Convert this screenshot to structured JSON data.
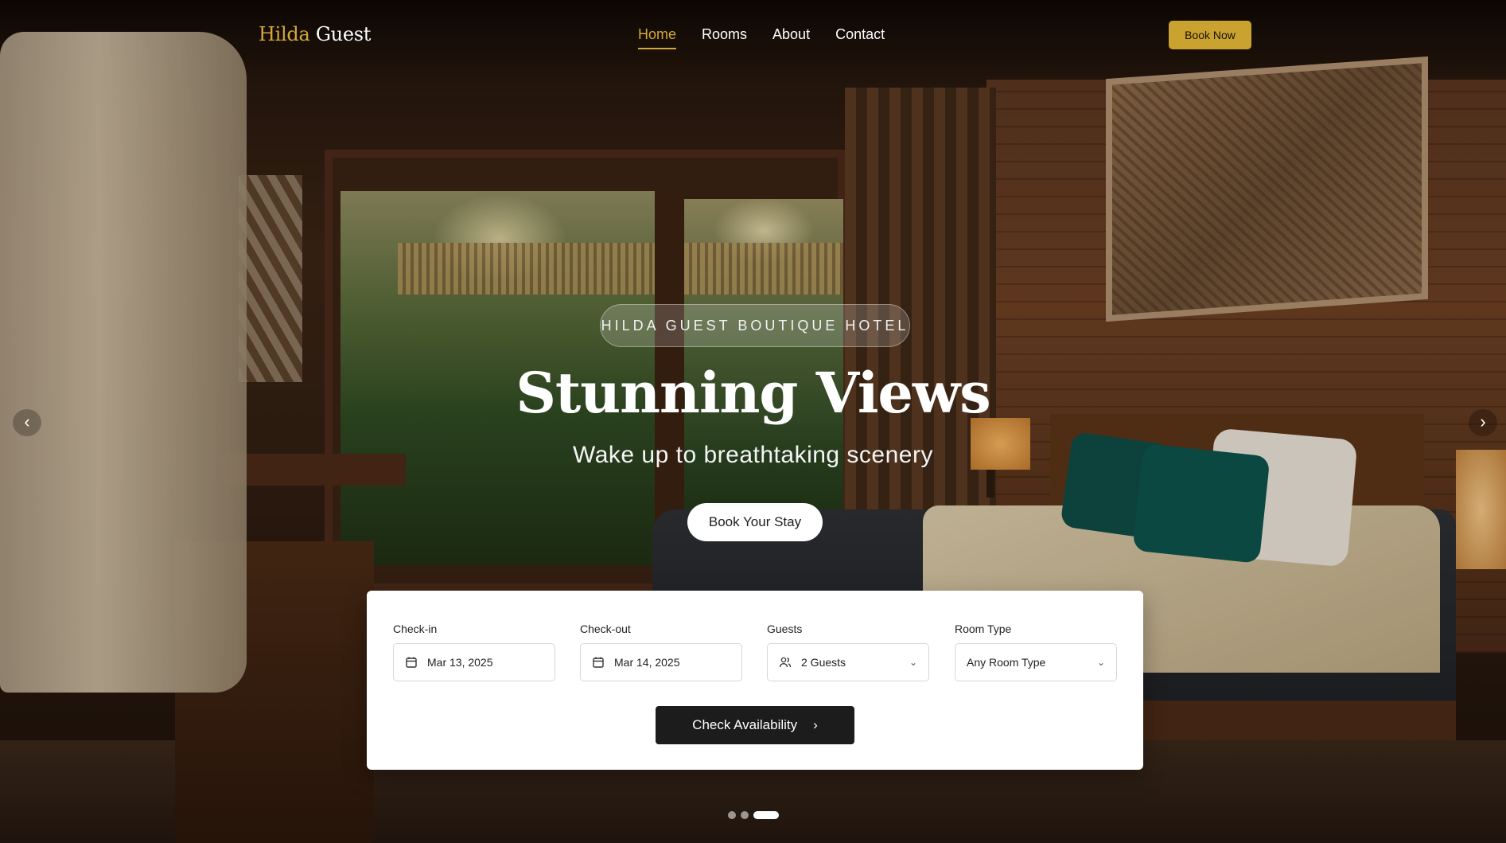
{
  "brand": {
    "first": "Hilda",
    "second": "Guest",
    "gold_color": "#d4a838"
  },
  "nav": {
    "links": [
      "Home",
      "Rooms",
      "About",
      "Contact"
    ],
    "active": "Home",
    "book_now": "Book Now"
  },
  "hero": {
    "tagline": "HILDA GUEST BOUTIQUE HOTEL",
    "headline": "Stunning Views",
    "subline": "Wake up to breathtaking scenery",
    "cta": "Book Your Stay",
    "prev_icon": "chevron-left-icon",
    "next_icon": "chevron-right-icon"
  },
  "booking": {
    "checkin_label": "Check-in",
    "checkin_value": "Mar 13, 2025",
    "checkout_label": "Check-out",
    "checkout_value": "Mar 14, 2025",
    "guests_label": "Guests",
    "guests_value": "2 Guests",
    "room_label": "Room Type",
    "room_value": "Any Room Type",
    "submit": "Check Availability"
  },
  "slider": {
    "slide_count": 3,
    "active_index": 2
  }
}
